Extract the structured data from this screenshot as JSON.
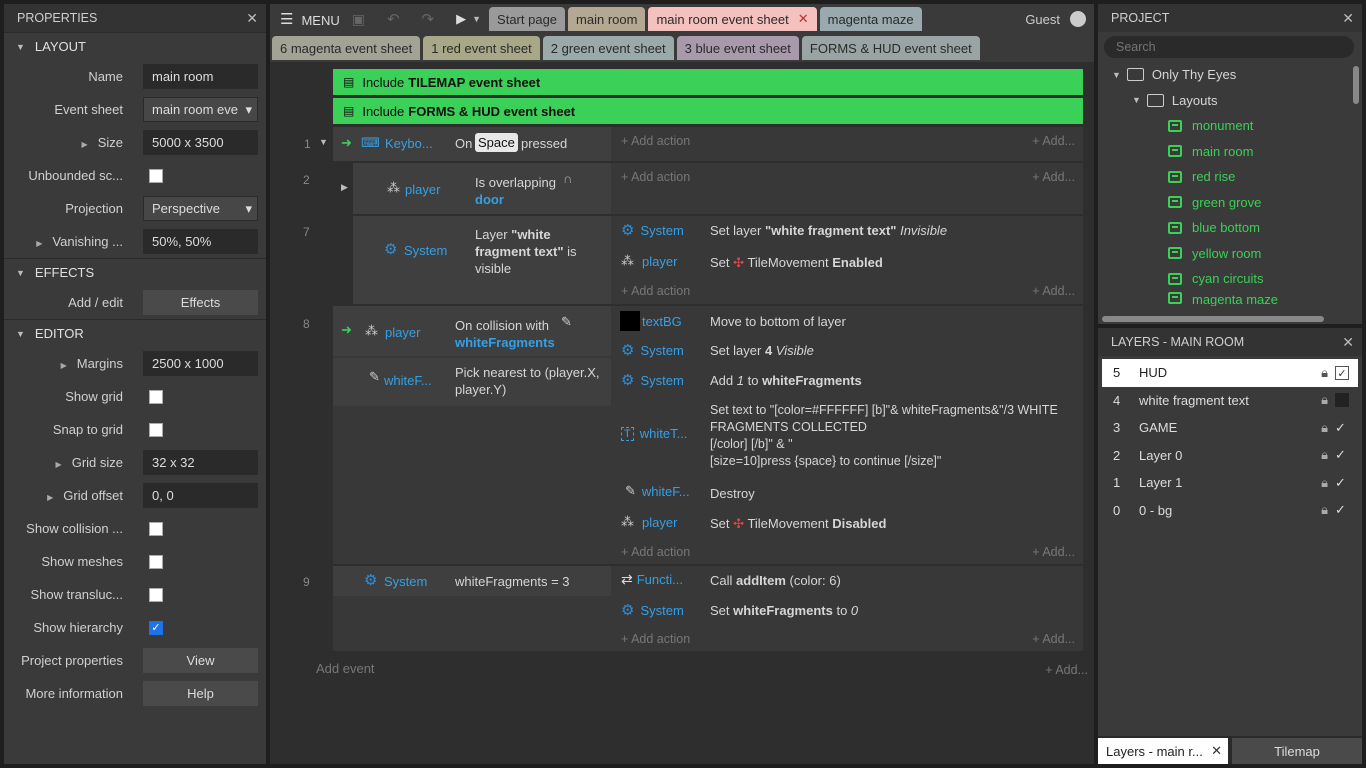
{
  "properties": {
    "title": "PROPERTIES",
    "layout_section": "LAYOUT",
    "name_label": "Name",
    "name_value": "main room",
    "event_sheet_label": "Event sheet",
    "event_sheet_value": "main room eve",
    "size_label": "Size",
    "size_value": "5000 x 3500",
    "unbounded_label": "Unbounded sc...",
    "projection_label": "Projection",
    "projection_value": "Perspective",
    "vanishing_label": "Vanishing ...",
    "vanishing_value": "50%, 50%",
    "effects_section": "EFFECTS",
    "addedit_label": "Add / edit",
    "effects_btn": "Effects",
    "editor_section": "EDITOR",
    "margins_label": "Margins",
    "margins_value": "2500 x 1000",
    "showgrid_label": "Show grid",
    "snap_label": "Snap to grid",
    "gridsize_label": "Grid size",
    "gridsize_value": "32 x 32",
    "gridoffset_label": "Grid offset",
    "gridoffset_value": "0, 0",
    "showcollision_label": "Show collision ...",
    "showmeshes_label": "Show meshes",
    "showtransluc_label": "Show transluc...",
    "showhier_label": "Show hierarchy",
    "projprops_label": "Project properties",
    "view_btn": "View",
    "moreinfo_label": "More information",
    "help_btn": "Help"
  },
  "toolbar": {
    "menu": "MENU",
    "guest": "Guest",
    "tabs": [
      "Start page",
      "main room",
      "main room event sheet",
      "magenta maze"
    ],
    "tabs2": [
      "6 magenta event sheet",
      "1 red event sheet",
      "2 green event sheet",
      "3 blue event sheet",
      "FORMS & HUD event sheet"
    ]
  },
  "events": {
    "include1_pre": "Include",
    "include1_name": "TILEMAP event sheet",
    "include2_pre": "Include",
    "include2_name": "FORMS & HUD event sheet",
    "n1": "1",
    "n2": "2",
    "n7": "7",
    "n8": "8",
    "n9": "9",
    "add_action": "+ Add action",
    "add_short": "+ Add...",
    "add_event": "Add event",
    "e1_obj": "Keybo...",
    "e1_cond_pre": "On",
    "e1_cond_key": "Space",
    "e1_cond_post": "pressed",
    "e2_obj": "player",
    "e2_cond": "Is overlapping",
    "e2_cond_obj": "door",
    "e7_obj": "System",
    "e7_cond1": "Layer",
    "e7_cond_b": "\"white fragment text\"",
    "e7_cond2": "is visible",
    "e7_a1_obj": "System",
    "e7_a1_pre": "Set layer",
    "e7_a1_b": "\"white fragment text\"",
    "e7_a1_i": "Invisible",
    "e7_a2_obj": "player",
    "e7_a2_pre": "Set",
    "e7_a2_mid": "TileMovement",
    "e7_a2_b": "Enabled",
    "e8_obj": "player",
    "e8_cond": "On collision with",
    "e8_cond_obj": "whiteFragments",
    "e8_obj2": "whiteF...",
    "e8_cond2": "Pick nearest to (player.X, player.Y)",
    "e8_a1_obj": "textBG",
    "e8_a1": "Move to bottom of layer",
    "e8_a2_obj": "System",
    "e8_a2_pre": "Set layer",
    "e8_a2_b": "4",
    "e8_a2_i": "Visible",
    "e8_a3_obj": "System",
    "e8_a3_pre": "Add",
    "e8_a3_i": "1",
    "e8_a3_mid": "to",
    "e8_a3_b": "whiteFragments",
    "e8_a4_obj": "whiteT...",
    "e8_a4_l1": "Set text to \"[color=#FFFFFF] [b]\"& whiteFragments&\"/3 WHITE",
    "e8_a4_l2": "FRAGMENTS COLLECTED",
    "e8_a4_l3": "[/color] [/b]\" & \"",
    "e8_a4_l4": "[size=10]press {space} to continue [/size]\"",
    "e8_a5_obj": "whiteF...",
    "e8_a5": "Destroy",
    "e8_a6_obj": "player",
    "e8_a6_pre": "Set",
    "e8_a6_mid": "TileMovement",
    "e8_a6_b": "Disabled",
    "e9_obj": "System",
    "e9_cond": "whiteFragments = 3",
    "e9_a1_obj": "Functi...",
    "e9_a1_pre": "Call",
    "e9_a1_b": "addItem",
    "e9_a1_post": "(color: 6)",
    "e9_a2_obj": "System",
    "e9_a2_pre": "Set",
    "e9_a2_b": "whiteFragments",
    "e9_a2_mid": "to",
    "e9_a2_i": "0"
  },
  "project": {
    "title": "PROJECT",
    "search_placeholder": "Search",
    "root": "Only Thy Eyes",
    "layouts": "Layouts",
    "items": [
      "monument",
      "main room",
      "red rise",
      "green grove",
      "blue bottom",
      "yellow room",
      "cyan circuits",
      "magenta maze"
    ]
  },
  "layers": {
    "title": "LAYERS - MAIN ROOM",
    "rows": [
      {
        "n": "5",
        "name": "HUD"
      },
      {
        "n": "4",
        "name": "white fragment text"
      },
      {
        "n": "3",
        "name": "GAME"
      },
      {
        "n": "2",
        "name": "Layer 0"
      },
      {
        "n": "1",
        "name": "Layer 1"
      },
      {
        "n": "0",
        "name": "0 - bg"
      }
    ],
    "bottom_tab1": "Layers - main r...",
    "bottom_tab2": "Tilemap"
  }
}
